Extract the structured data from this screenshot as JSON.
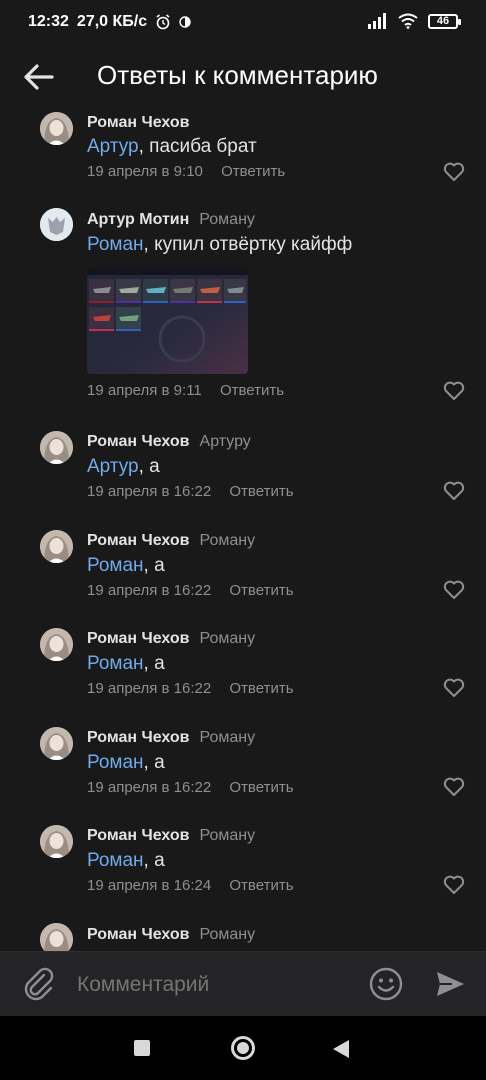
{
  "status_bar": {
    "time": "12:32",
    "speed": "27,0 КБ/с",
    "battery": "46"
  },
  "header": {
    "title": "Ответы к комментарию"
  },
  "comments": [
    {
      "author": "Роман Чехов",
      "reply_to": "",
      "mention": "Артур",
      "text": ", пасиба брат",
      "date": "19 апреля в 9:10",
      "reply_label": "Ответить"
    },
    {
      "author": "Артур Мотин",
      "reply_to": "Роману",
      "mention": "Роман",
      "text": ",  купил отвёртку кайфф",
      "date": "19 апреля в 9:11",
      "reply_label": "Ответить"
    },
    {
      "author": "Роман Чехов",
      "reply_to": "Артуру",
      "mention": "Артур",
      "text": ", а",
      "date": "19 апреля в 16:22",
      "reply_label": "Ответить"
    },
    {
      "author": "Роман Чехов",
      "reply_to": "Роману",
      "mention": "Роман",
      "text": ", а",
      "date": "19 апреля в 16:22",
      "reply_label": "Ответить"
    },
    {
      "author": "Роман Чехов",
      "reply_to": "Роману",
      "mention": "Роман",
      "text": ", а",
      "date": "19 апреля в 16:22",
      "reply_label": "Ответить"
    },
    {
      "author": "Роман Чехов",
      "reply_to": "Роману",
      "mention": "Роман",
      "text": ", а",
      "date": "19 апреля в 16:22",
      "reply_label": "Ответить"
    },
    {
      "author": "Роман Чехов",
      "reply_to": "Роману",
      "mention": "Роман",
      "text": ", а",
      "date": "19 апреля в 16:24",
      "reply_label": "Ответить"
    },
    {
      "author": "Роман Чехов",
      "reply_to": "Роману"
    }
  ],
  "comment_bar": {
    "placeholder": "Комментарий"
  },
  "colors": {
    "background": "#19191a",
    "mention": "#71aaeb",
    "secondary_text": "#8d8f93",
    "primary_text": "#e1e3e6"
  }
}
